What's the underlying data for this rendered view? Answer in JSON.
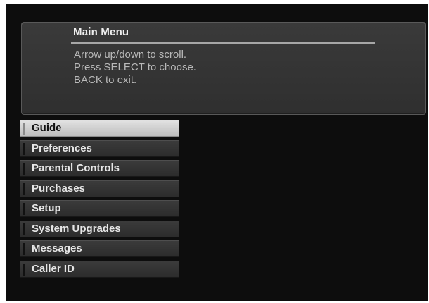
{
  "header": {
    "title": "Main Menu",
    "instructions": [
      "Arrow up/down to scroll.",
      "Press SELECT to choose.",
      "BACK to exit."
    ]
  },
  "menu": {
    "items": [
      {
        "label": "Guide",
        "selected": true
      },
      {
        "label": "Preferences",
        "selected": false
      },
      {
        "label": "Parental Controls",
        "selected": false
      },
      {
        "label": "Purchases",
        "selected": false
      },
      {
        "label": "Setup",
        "selected": false
      },
      {
        "label": "System Upgrades",
        "selected": false
      },
      {
        "label": "Messages",
        "selected": false
      },
      {
        "label": "Caller ID",
        "selected": false
      }
    ]
  },
  "colors": {
    "background": "#0d0d0d",
    "panel": "#333333",
    "selected_item": "#cfcfcf",
    "menu_item": "#333333",
    "text_primary": "#efefef",
    "text_help": "#b9b9b9"
  }
}
